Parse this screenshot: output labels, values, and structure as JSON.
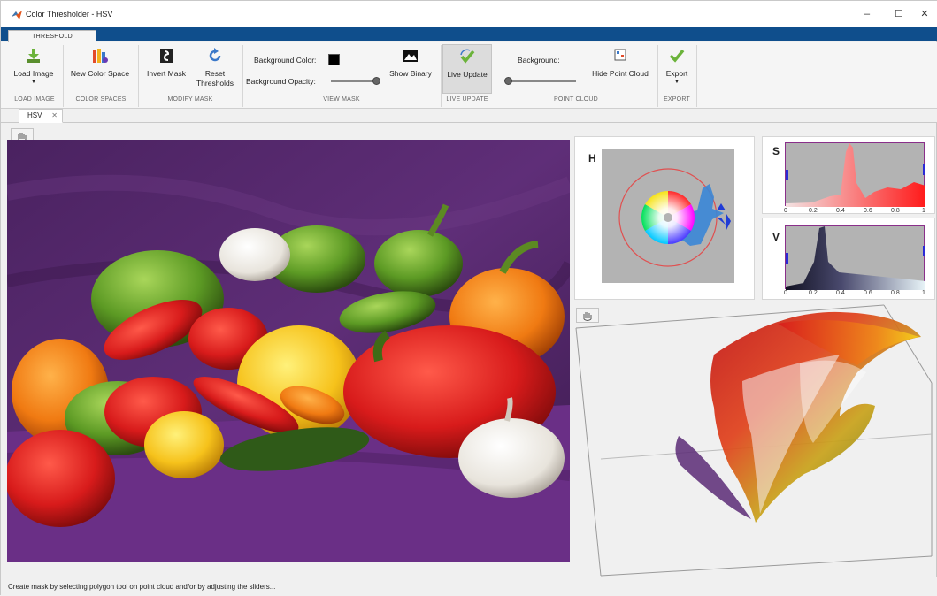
{
  "window": {
    "title": "Color Thresholder - HSV",
    "minimize_glyph": "–",
    "maximize_glyph": "☐",
    "close_glyph": "✕"
  },
  "ribbon": {
    "tab_label": "THRESHOLD",
    "load_image": {
      "label": "Load Image",
      "icon": "download-arrow-icon",
      "section": "LOAD IMAGE"
    },
    "new_color_space": {
      "label": "New Color Space",
      "icon": "color-bars-icon",
      "section": "COLOR SPACES"
    },
    "invert_mask": {
      "label": "Invert Mask",
      "icon": "invert-mask-icon"
    },
    "reset_thresholds": {
      "label_line1": "Reset",
      "label_line2": "Thresholds",
      "icon": "reset-icon"
    },
    "modify_mask_section": "MODIFY MASK",
    "background_color_label": "Background Color:",
    "background_color": "#000000",
    "background_opacity_label": "Background Opacity:",
    "background_opacity": 1.0,
    "show_binary": {
      "label": "Show Binary",
      "icon": "binary-image-icon"
    },
    "view_mask_section": "VIEW MASK",
    "live_update": {
      "label": "Live Update",
      "icon": "checkmark-icon",
      "section": "LIVE UPDATE",
      "active": true
    },
    "point_cloud_background_label": "Background:",
    "point_cloud_background": 0.0,
    "hide_point_cloud": {
      "label": "Hide Point Cloud",
      "icon": "hide-cloud-icon"
    },
    "point_cloud_section": "POINT CLOUD",
    "export": {
      "label": "Export",
      "icon": "checkmark-icon",
      "section": "EXPORT"
    }
  },
  "document_tab": {
    "label": "HSV",
    "close": "✕"
  },
  "channels": {
    "hue_label": "H",
    "saturation_label": "S",
    "value_label": "V",
    "saturation_ticks": [
      "0",
      "0.2",
      "0.4",
      "0.6",
      "0.8",
      "1"
    ],
    "value_ticks": [
      "0",
      "0.2",
      "0.4",
      "0.6",
      "0.8",
      "1"
    ]
  },
  "accent_color": "#0f4e8c",
  "status_text": "Create mask by selecting polygon tool on point cloud and/or by adjusting the sliders..."
}
